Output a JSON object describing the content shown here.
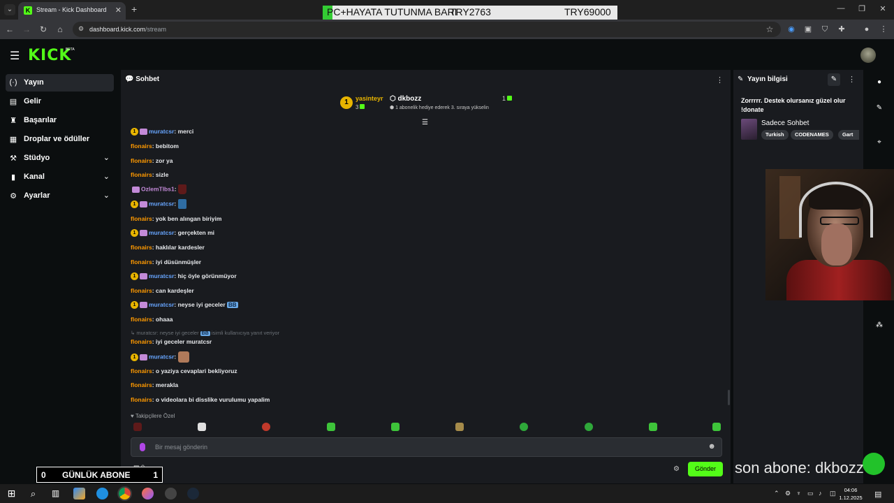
{
  "browser": {
    "tab_title": "Stream - Kick Dashboard",
    "url_host": "dashboard.kick.com",
    "url_path": "/stream"
  },
  "top_overlay": {
    "left_text": "PC+HAYATA TUTUNMA BARI",
    "mid_text": "TRY2763",
    "right_text": "TRY69000"
  },
  "header": {
    "logo": "KICK",
    "beta": "BETA"
  },
  "sidebar": {
    "items": [
      {
        "label": "Yayın",
        "icon": "broadcast-icon"
      },
      {
        "label": "Gelir",
        "icon": "revenue-icon"
      },
      {
        "label": "Başarılar",
        "icon": "trophy-icon"
      },
      {
        "label": "Droplar ve ödüller",
        "icon": "drops-icon"
      },
      {
        "label": "Stüdyo",
        "icon": "studio-icon"
      },
      {
        "label": "Kanal",
        "icon": "channel-icon"
      },
      {
        "label": "Ayarlar",
        "icon": "settings-icon"
      }
    ]
  },
  "chat": {
    "title": "Sohbet",
    "pinned": {
      "user": "yasinteyr",
      "sub_count": "3",
      "gifter": "dkbozz",
      "gift_count": "1",
      "description": "1 abonelik hediye ederek 3. sıraya yükselin"
    },
    "messages": [
      {
        "user": "muratcsr",
        "color": "blue",
        "badges": true,
        "text": "merci"
      },
      {
        "user": "flonairs",
        "color": "orange",
        "badges": false,
        "text": "bebitom"
      },
      {
        "user": "flonairs",
        "color": "orange",
        "badges": false,
        "text": "zor ya"
      },
      {
        "user": "flonairs",
        "color": "orange",
        "badges": false,
        "text": "sizle"
      },
      {
        "user": "OzlemTlbs1",
        "color": "purple",
        "badges": false,
        "text": ""
      },
      {
        "user": "muratcsr",
        "color": "blue",
        "badges": true,
        "text": ""
      },
      {
        "user": "flonairs",
        "color": "orange",
        "badges": false,
        "text": "yok ben alıngan biriyim"
      },
      {
        "user": "muratcsr",
        "color": "blue",
        "badges": true,
        "text": "gerçekten mi"
      },
      {
        "user": "flonairs",
        "color": "orange",
        "badges": false,
        "text": "haklılar kardesler"
      },
      {
        "user": "flonairs",
        "color": "orange",
        "badges": false,
        "text": "iyi düsünmüşler"
      },
      {
        "user": "muratcsr",
        "color": "blue",
        "badges": true,
        "text": "hiç öyle görünmüyor"
      },
      {
        "user": "flonairs",
        "color": "orange",
        "badges": false,
        "text": "can kardeşler"
      },
      {
        "user": "muratcsr",
        "color": "blue",
        "badges": true,
        "text": "neyse iyi geceler"
      },
      {
        "user": "flonairs",
        "color": "orange",
        "badges": false,
        "text": "ohaaa"
      },
      {
        "user": "flonairs",
        "color": "orange",
        "badges": false,
        "text": "iyi geceler muratcsr"
      },
      {
        "user": "muratcsr",
        "color": "blue",
        "badges": true,
        "text": ""
      },
      {
        "user": "flonairs",
        "color": "orange",
        "badges": false,
        "text": "o yaziya cevaplari bekliyoruz"
      },
      {
        "user": "flonairs",
        "color": "orange",
        "badges": false,
        "text": "merakla"
      },
      {
        "user": "flonairs",
        "color": "orange",
        "badges": false,
        "text": "o videolara bi disslike vurulumu yapalim"
      }
    ],
    "reply_line": {
      "prefix": "muratcsr: neyse iyi geceler",
      "suffix": "isimli kullanıcıya yanıt veriyor"
    },
    "emote_bb": "BB",
    "followers_label": "Takipçilere Özel",
    "input_placeholder": "Bir mesaj gönderin",
    "send_label": "Gönder",
    "counter": "0"
  },
  "stream_info": {
    "title": "Yayın bilgisi",
    "description": "Zorrrrr. Destek olursanız güzel olur !donate",
    "category": "Sadece Sohbet",
    "tags": [
      "Turkish",
      "CODENAMES",
      "Gart"
    ]
  },
  "overlay_bottom": {
    "last_sub": "son abone: dkbozz",
    "daily_left": "0",
    "daily_label": "GÜNLÜK ABONE",
    "daily_right": "1"
  },
  "taskbar": {
    "time": "04:06",
    "date": "1.12.2025"
  },
  "colors": {
    "accent": "#53fc18",
    "user_blue": "#67a5ff",
    "user_orange": "#ff9900",
    "user_purple": "#c38ad8",
    "badge_gold": "#e8b400"
  }
}
